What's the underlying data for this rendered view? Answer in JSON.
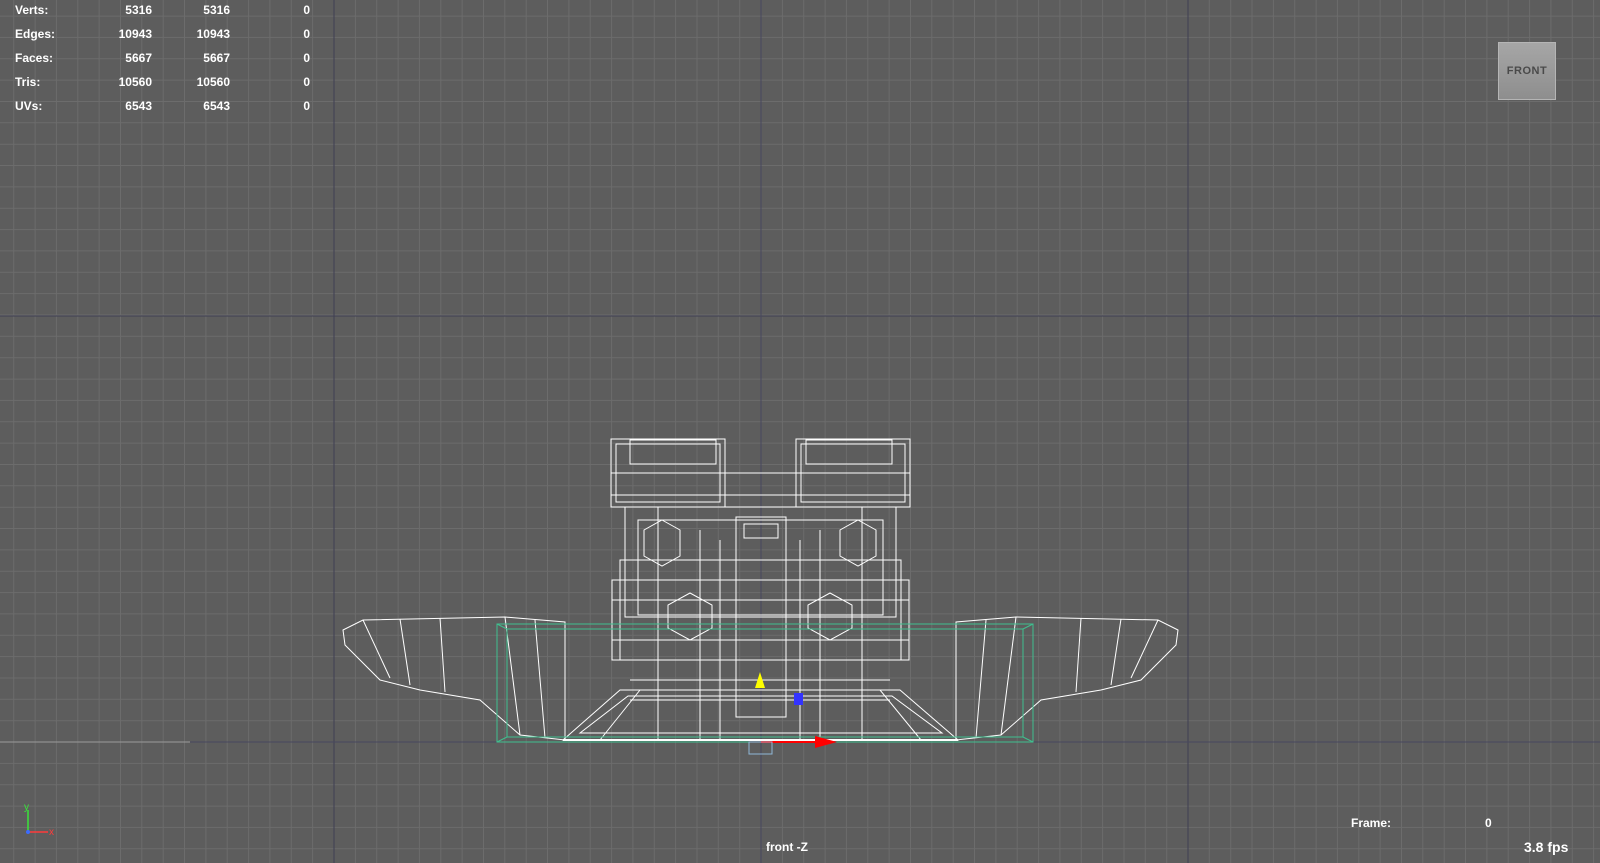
{
  "poly_count": {
    "rows": [
      {
        "label": "Verts:",
        "c1": "5316",
        "c2": "5316",
        "c3": "0"
      },
      {
        "label": "Edges:",
        "c1": "10943",
        "c2": "10943",
        "c3": "0"
      },
      {
        "label": "Faces:",
        "c1": "5667",
        "c2": "5667",
        "c3": "0"
      },
      {
        "label": "Tris:",
        "c1": "10560",
        "c2": "10560",
        "c3": "0"
      },
      {
        "label": "UVs:",
        "c1": "6543",
        "c2": "6543",
        "c3": "0"
      }
    ]
  },
  "viewcube": {
    "label": "FRONT"
  },
  "camera": {
    "label": "front -Z"
  },
  "frame": {
    "label": "Frame:",
    "value": "0"
  },
  "fps": {
    "label": "3.8 fps"
  },
  "axis_gizmo": {
    "y_label": "y",
    "x_label": "x"
  },
  "colors": {
    "background": "#5d5d5d",
    "grid_line": "#6c6c6c",
    "grid_major": "#3c3c54",
    "wireframe": "#ffffff",
    "selection_box": "#3fbf8f",
    "manip_x": "#ff0000",
    "manip_y": "#ffff00",
    "manip_z": "#3333ff"
  }
}
